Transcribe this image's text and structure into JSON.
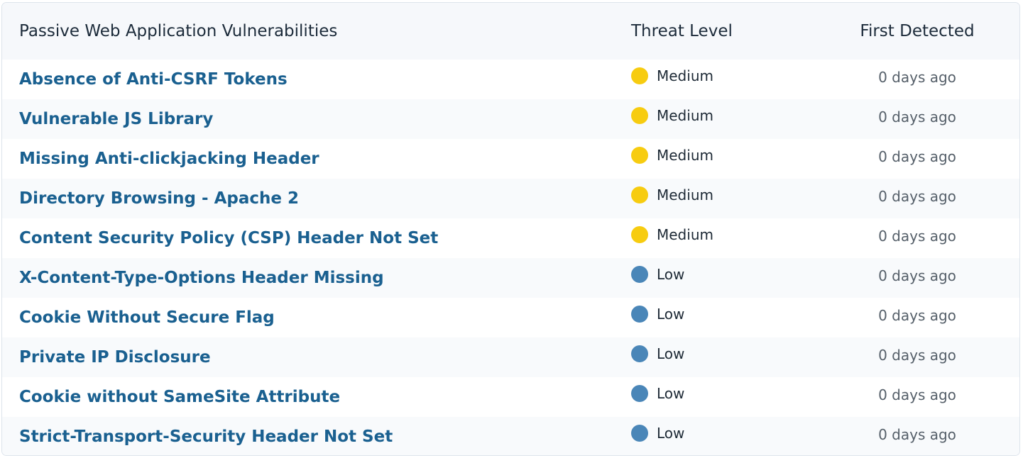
{
  "table": {
    "headers": {
      "name": "Passive Web Application Vulnerabilities",
      "level": "Threat Level",
      "date": "First Detected"
    },
    "level_colors": {
      "Medium": "#f7cc10",
      "Low": "#4a86b8"
    },
    "rows": [
      {
        "name": "Absence of Anti-CSRF Tokens",
        "level": "Medium",
        "detected": "0 days ago"
      },
      {
        "name": "Vulnerable JS Library",
        "level": "Medium",
        "detected": "0 days ago"
      },
      {
        "name": "Missing Anti-clickjacking Header",
        "level": "Medium",
        "detected": "0 days ago"
      },
      {
        "name": "Directory Browsing - Apache 2",
        "level": "Medium",
        "detected": "0 days ago"
      },
      {
        "name": "Content Security Policy (CSP) Header Not Set",
        "level": "Medium",
        "detected": "0 days ago"
      },
      {
        "name": "X-Content-Type-Options Header Missing",
        "level": "Low",
        "detected": "0 days ago"
      },
      {
        "name": "Cookie Without Secure Flag",
        "level": "Low",
        "detected": "0 days ago"
      },
      {
        "name": "Private IP Disclosure",
        "level": "Low",
        "detected": "0 days ago"
      },
      {
        "name": "Cookie without SameSite Attribute",
        "level": "Low",
        "detected": "0 days ago"
      },
      {
        "name": "Strict-Transport-Security Header Not Set",
        "level": "Low",
        "detected": "0 days ago"
      }
    ]
  }
}
